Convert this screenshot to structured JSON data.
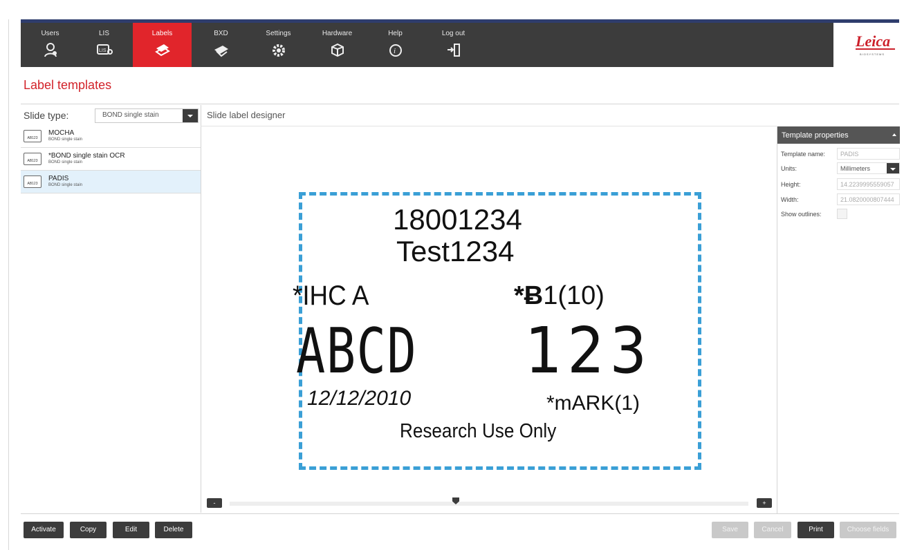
{
  "nav": {
    "items": [
      {
        "label": "Users",
        "icon": "users-icon"
      },
      {
        "label": "LIS",
        "icon": "lis-icon"
      },
      {
        "label": "Labels",
        "icon": "labels-icon",
        "active": true
      },
      {
        "label": "BXD",
        "icon": "bxd-icon"
      },
      {
        "label": "Settings",
        "icon": "settings-gear-icon"
      },
      {
        "label": "Hardware",
        "icon": "hardware-icon"
      },
      {
        "label": "Help",
        "icon": "help-icon"
      },
      {
        "label": "Log out",
        "icon": "logout-icon"
      }
    ],
    "active_color": "#e1252b",
    "bar_color": "#3c3c3c"
  },
  "logo": {
    "text": "Leica",
    "subtext": "BIOSYSTEMS"
  },
  "page_title": "Label templates",
  "left_panel": {
    "slide_type_label": "Slide type:",
    "slide_type_value": "BOND single stain",
    "templates": [
      {
        "name": "MOCHA",
        "sub": "BOND single stain",
        "icon_text": "AB123",
        "selected": false
      },
      {
        "name": "*BOND single stain OCR",
        "sub": "BOND single stain",
        "icon_text": "AB123",
        "selected": false
      },
      {
        "name": "PADIS",
        "sub": "BOND single stain",
        "icon_text": "AB123",
        "selected": true
      }
    ]
  },
  "designer": {
    "title": "Slide label designer",
    "label": {
      "line1": "18001234",
      "line2": "Test1234",
      "left_mid": "*IHC A",
      "right_mid_prefix": "*",
      "right_mid_glyph": "Ƀ",
      "right_mid_suffix": "1(10)",
      "big_left": "ABCD",
      "big_right": "123",
      "date": "12/12/2010",
      "mark": "*mARK(1)",
      "footer": "Research Use Only"
    },
    "outline_color": "#3a9fd6",
    "zoom_minus": "-",
    "zoom_plus": "+"
  },
  "properties": {
    "title": "Template properties",
    "template_name_label": "Template name:",
    "template_name_value": "PADIS",
    "units_label": "Units:",
    "units_value": "Millimeters",
    "height_label": "Height:",
    "height_value": "14.2239995559057",
    "width_label": "Width:",
    "width_value": "21.0820000807444",
    "show_outlines_label": "Show outlines:"
  },
  "buttons": {
    "activate": "Activate",
    "copy": "Copy",
    "edit": "Edit",
    "delete": "Delete",
    "save": "Save",
    "cancel": "Cancel",
    "print": "Print",
    "choose_fields": "Choose fields"
  }
}
